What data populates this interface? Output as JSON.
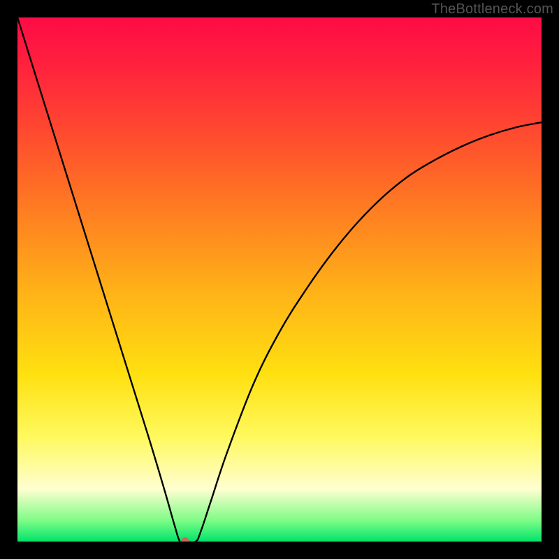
{
  "watermark": "TheBottleneck.com",
  "chart_data": {
    "type": "line",
    "title": "",
    "xlabel": "",
    "ylabel": "",
    "xlim": [
      0,
      100
    ],
    "ylim": [
      0,
      100
    ],
    "grid": false,
    "legend": false,
    "series": [
      {
        "name": "bottleneck-curve",
        "x": [
          0,
          5,
          10,
          15,
          20,
          25,
          28,
          30,
          31,
          32,
          34,
          35,
          37,
          40,
          45,
          50,
          55,
          60,
          65,
          70,
          75,
          80,
          85,
          90,
          95,
          100
        ],
        "values": [
          100,
          84,
          68,
          52,
          36,
          20,
          10,
          3,
          0,
          0,
          0,
          2,
          8,
          17,
          30,
          40,
          48,
          55,
          61,
          66,
          70,
          73,
          75.5,
          77.5,
          79,
          80
        ]
      }
    ],
    "marker": {
      "x": 32,
      "y": 0,
      "color": "#c66a5a",
      "radius_px": 6
    },
    "background_gradient": {
      "direction": "vertical",
      "stops": [
        {
          "pos": 0.0,
          "color": "#ff0b46"
        },
        {
          "pos": 0.08,
          "color": "#ff1e3e"
        },
        {
          "pos": 0.22,
          "color": "#ff4a2f"
        },
        {
          "pos": 0.36,
          "color": "#ff7a22"
        },
        {
          "pos": 0.52,
          "color": "#ffb118"
        },
        {
          "pos": 0.68,
          "color": "#ffe010"
        },
        {
          "pos": 0.8,
          "color": "#fff95e"
        },
        {
          "pos": 0.9,
          "color": "#fffed0"
        },
        {
          "pos": 0.96,
          "color": "#7dfc86"
        },
        {
          "pos": 1.0,
          "color": "#00e46b"
        }
      ]
    }
  }
}
